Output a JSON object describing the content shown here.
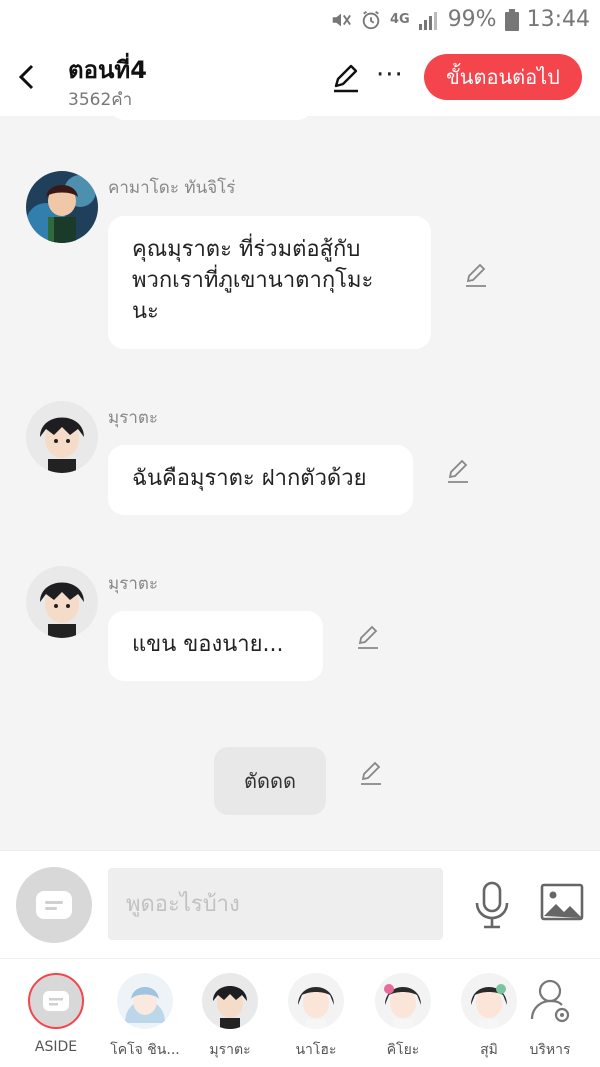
{
  "status_bar": {
    "battery": "99%",
    "time": "13:44",
    "network": "4G"
  },
  "header": {
    "title": "ตอนที่4",
    "word_count": "3562คำ",
    "more": "···",
    "next_button": "ขั้นตอนต่อไป"
  },
  "messages": [
    {
      "speaker": "คามาโดะ ทันจิโร่",
      "text_lines": [
        "คุณมุราตะ ที่ร่วมต่อสู้กับ",
        "พวกเราที่ภูเขานาตากุโมะ",
        "นะ"
      ]
    },
    {
      "speaker": "มุราตะ",
      "text_lines": [
        "ฉันคือมุราตะ ฝากตัวด้วย"
      ]
    },
    {
      "speaker": "มุราตะ",
      "text_lines": [
        "แขน ของนาย..."
      ]
    }
  ],
  "narration": "ตัดดด",
  "input": {
    "placeholder": "พูดอะไรบ้าง"
  },
  "characters": [
    {
      "label": "ASIDE"
    },
    {
      "label": "โคโจ ชิน..."
    },
    {
      "label": "มุราตะ"
    },
    {
      "label": "นาโฮะ"
    },
    {
      "label": "คิโยะ"
    },
    {
      "label": "สุมิ"
    },
    {
      "label": "บริหาร"
    }
  ],
  "colors": {
    "accent": "#f5454c",
    "bubble": "#ffffff",
    "background": "#f4f4f4"
  },
  "icons": {
    "back": "chevron-left-icon",
    "edit": "pencil-icon",
    "more": "more-icon",
    "mic": "microphone-icon",
    "image": "image-icon",
    "manage": "user-gear-icon"
  }
}
